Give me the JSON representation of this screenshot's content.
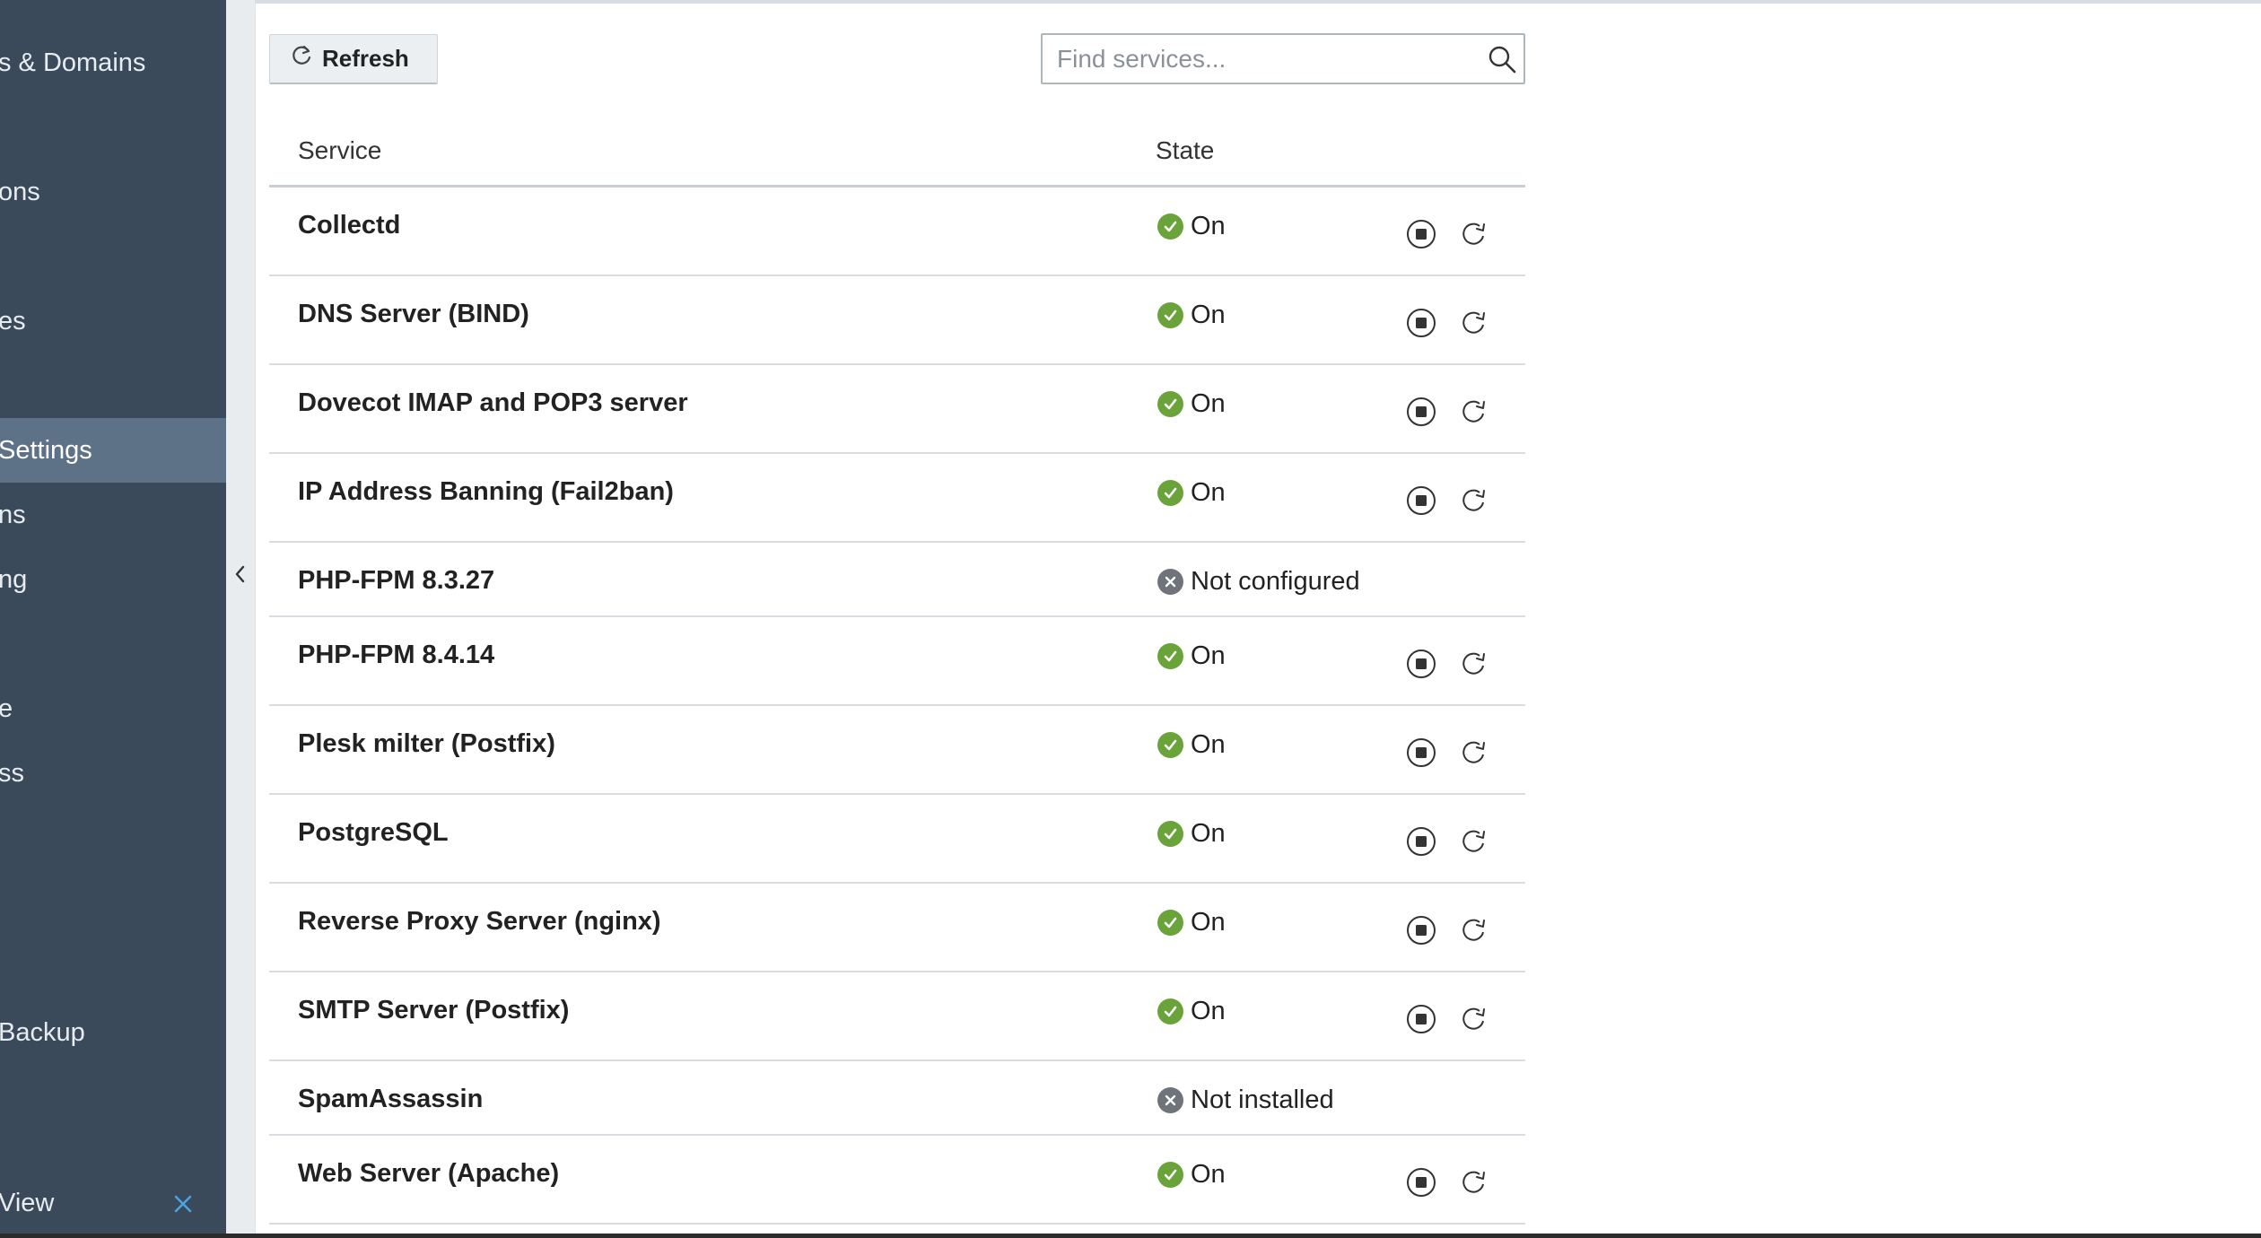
{
  "sidebar": {
    "items": [
      {
        "label": "s & Domains",
        "active": false
      },
      {
        "label": "ons",
        "active": false
      },
      {
        "label": "es",
        "active": false
      },
      {
        "label": "Settings",
        "active": true
      },
      {
        "label": "ns",
        "active": false
      },
      {
        "label": "ng",
        "active": false
      },
      {
        "label": "e",
        "active": false
      },
      {
        "label": "ss",
        "active": false
      },
      {
        "label": "Backup",
        "active": false
      }
    ],
    "bottom_label": "View"
  },
  "toolbar": {
    "refresh_label": "Refresh",
    "search_placeholder": "Find services..."
  },
  "table": {
    "columns": [
      "Service",
      "State"
    ],
    "rows": [
      {
        "service": "Collectd",
        "state": "On",
        "running": true
      },
      {
        "service": "DNS Server (BIND)",
        "state": "On",
        "running": true
      },
      {
        "service": "Dovecot IMAP and POP3 server",
        "state": "On",
        "running": true
      },
      {
        "service": "IP Address Banning (Fail2ban)",
        "state": "On",
        "running": true
      },
      {
        "service": "PHP-FPM 8.3.27",
        "state": "Not configured",
        "running": false
      },
      {
        "service": "PHP-FPM 8.4.14",
        "state": "On",
        "running": true
      },
      {
        "service": "Plesk milter (Postfix)",
        "state": "On",
        "running": true
      },
      {
        "service": "PostgreSQL",
        "state": "On",
        "running": true
      },
      {
        "service": "Reverse Proxy Server (nginx)",
        "state": "On",
        "running": true
      },
      {
        "service": "SMTP Server (Postfix)",
        "state": "On",
        "running": true
      },
      {
        "service": "SpamAssassin",
        "state": "Not installed",
        "running": false
      },
      {
        "service": "Web Server (Apache)",
        "state": "On",
        "running": true
      }
    ]
  },
  "colors": {
    "sidebar_bg": "#3b4a5a",
    "sidebar_active": "#5d7287",
    "status_ok": "#6aa33a",
    "status_off": "#6f747a",
    "close_accent": "#4aa3df"
  }
}
